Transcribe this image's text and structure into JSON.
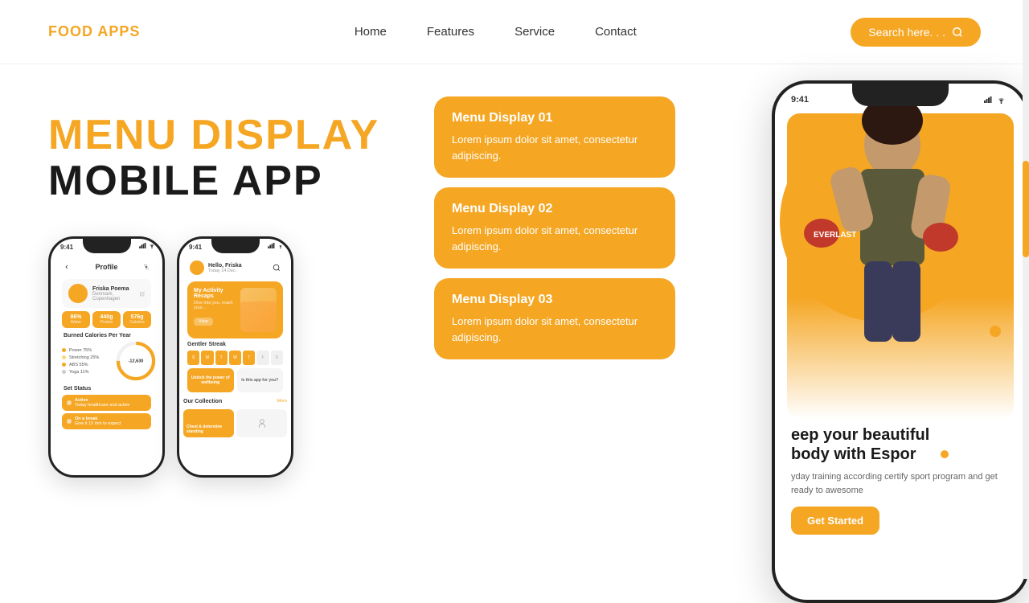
{
  "brand": {
    "logo": "FOOD APPS"
  },
  "nav": {
    "links": [
      {
        "label": "Home",
        "name": "home"
      },
      {
        "label": "Features",
        "name": "features"
      },
      {
        "label": "Service",
        "name": "service"
      },
      {
        "label": "Contact",
        "name": "contact"
      }
    ],
    "search_placeholder": "Search here. . ."
  },
  "hero": {
    "title_orange": "MENU DISPLAY",
    "title_black": "MOBILE APP"
  },
  "menu_cards": [
    {
      "title": "Menu Display 01",
      "text": "Lorem ipsum dolor sit amet, consectetur adipiscing."
    },
    {
      "title": "Menu Display 02",
      "text": "Lorem ipsum dolor sit amet, consectetur adipiscing."
    },
    {
      "title": "Menu Display 03",
      "text": "Lorem ipsum dolor sit amet, consectetur adipiscing."
    }
  ],
  "phone1": {
    "time": "9:41",
    "title": "Profile",
    "name": "Friska Poema",
    "location": "Denmark, Copenhagen",
    "stats": [
      {
        "val": "86%",
        "label": "Water"
      },
      {
        "val": "440g",
        "label": "Protein"
      },
      {
        "val": "576g",
        "label": "Calories"
      }
    ],
    "chart_title": "Burned Calories Per Year",
    "bars": [
      {
        "label": "Power 75%",
        "pct": 75,
        "color": "#F5A623"
      },
      {
        "label": "Stretching 25%",
        "pct": 25,
        "color": "#FFD580"
      },
      {
        "label": "ABS 55%",
        "pct": 55,
        "color": "#F5A623"
      },
      {
        "label": "Yoga 11%",
        "pct": 11,
        "color": "#ccc"
      }
    ],
    "donut_value": "-12,630",
    "status_title": "Set Status",
    "statuses": [
      {
        "label": "Active",
        "sub": "Today healthcare and active"
      },
      {
        "label": "On a break",
        "sub": "Give it 15 min to expect"
      }
    ]
  },
  "phone2": {
    "time": "9:41",
    "name": "Hello, Friska",
    "date": "Today 14 Dec.",
    "card_title": "My Activity Recaps",
    "card_desc": "Dive into you, reach your...",
    "card_btn": "View",
    "streak_title": "Gentler Streak",
    "days": [
      "S",
      "M",
      "T",
      "W",
      "T",
      "F",
      "S"
    ],
    "active_days": [
      0,
      1,
      2,
      3,
      4
    ],
    "collection_title": "Our Collection",
    "items": [
      {
        "label": "Chest & determine standing"
      },
      {
        "label": ""
      }
    ]
  },
  "big_phone": {
    "time": "9:41",
    "hero_text_1": "eep your beautiful",
    "hero_text_2": "body with Espor",
    "body_text": "yday training according certify sport program and get ready to awesome",
    "cta": "Get Started"
  },
  "colors": {
    "orange": "#F5A623",
    "dark": "#1a1a1a",
    "white": "#ffffff"
  }
}
